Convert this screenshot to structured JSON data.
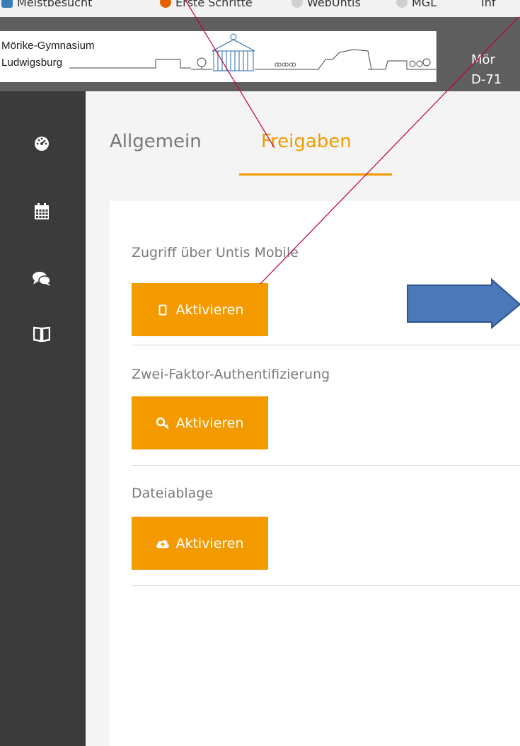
{
  "bookmarks": [
    {
      "label": "Meistbesucht",
      "icon": "bookmark-folder-icon",
      "color": "#3d7ab8"
    },
    {
      "label": "Erste Schritte",
      "icon": "firefox-icon",
      "color": "#e66000"
    },
    {
      "label": "WebUntis",
      "icon": "globe-icon",
      "color": "#9a9a9a"
    },
    {
      "label": "MGL",
      "icon": "globe-icon",
      "color": "#9a9a9a"
    },
    {
      "label": "Inf",
      "icon": "text",
      "color": "#333333"
    }
  ],
  "header": {
    "logo_line1": "Mörike-Gymnasium",
    "logo_line2": "Ludwigsburg",
    "school_line1": "Mör",
    "school_line2": "D-71"
  },
  "sidebar": {
    "items": [
      {
        "icon": "dashboard-icon"
      },
      {
        "icon": "calendar-icon"
      },
      {
        "icon": "chat-icon"
      },
      {
        "icon": "book-icon"
      }
    ]
  },
  "tabs": [
    {
      "label": "Allgemein",
      "active": false
    },
    {
      "label": "Freigaben",
      "active": true
    }
  ],
  "sections": [
    {
      "label": "Zugriff über Untis Mobile",
      "button": "Aktivieren",
      "icon": "mobile-icon"
    },
    {
      "label": "Zwei-Faktor-Authentifizierung",
      "button": "Aktivieren",
      "icon": "key-icon"
    },
    {
      "label": "Dateiablage",
      "button": "Aktivieren",
      "icon": "cloud-upload-icon"
    }
  ],
  "colors": {
    "accent": "#f39a00",
    "header_bg": "#5f5f5f",
    "sidebar_bg": "#3b3b3b",
    "annotation_line": "#c0002a",
    "annotation_arrow": "#4a78b8"
  }
}
